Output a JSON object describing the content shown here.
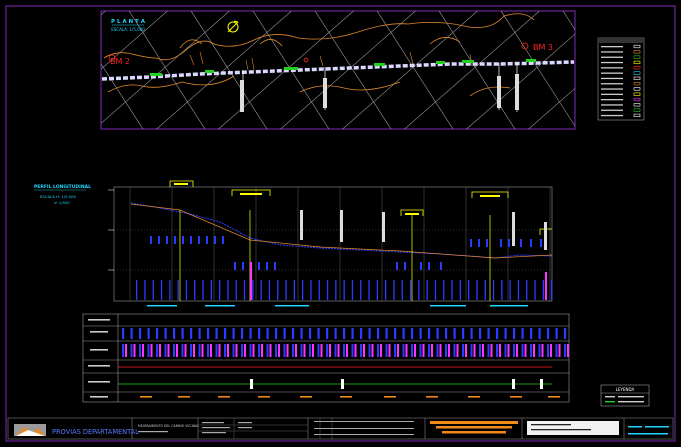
{
  "plan": {
    "scale_title": "P L A N T A",
    "scale_value": "ESCALA: 1/5,000",
    "label_left": "BM 2",
    "label_right": "BM 3"
  },
  "profile": {
    "title": "PERFIL LONGITUDINAL",
    "scale_h": "ESCALA H: 1/5,000",
    "scale_v": "V: 1/500"
  },
  "legend": {
    "title": "LEYENDA"
  },
  "title_block": {
    "company": "PROVIAS DEPARTAMENTAL",
    "project": "MEJORAMIENTO DEL CAMINO VECINAL"
  },
  "colors": {
    "background": "#000000",
    "frame": "#7f2ab8",
    "grid": "#9a9a9a",
    "road": "#d9d9ff",
    "terrain": "#e3892a",
    "accent_green": "#22d11a",
    "highlight_yellow": "#ffff00",
    "profile_blue": "#2a3cff",
    "marker_magenta": "#ff33ff",
    "accent_red": "#ff2222",
    "cyan": "#22d6ff",
    "orange_bar": "#f08a18"
  }
}
